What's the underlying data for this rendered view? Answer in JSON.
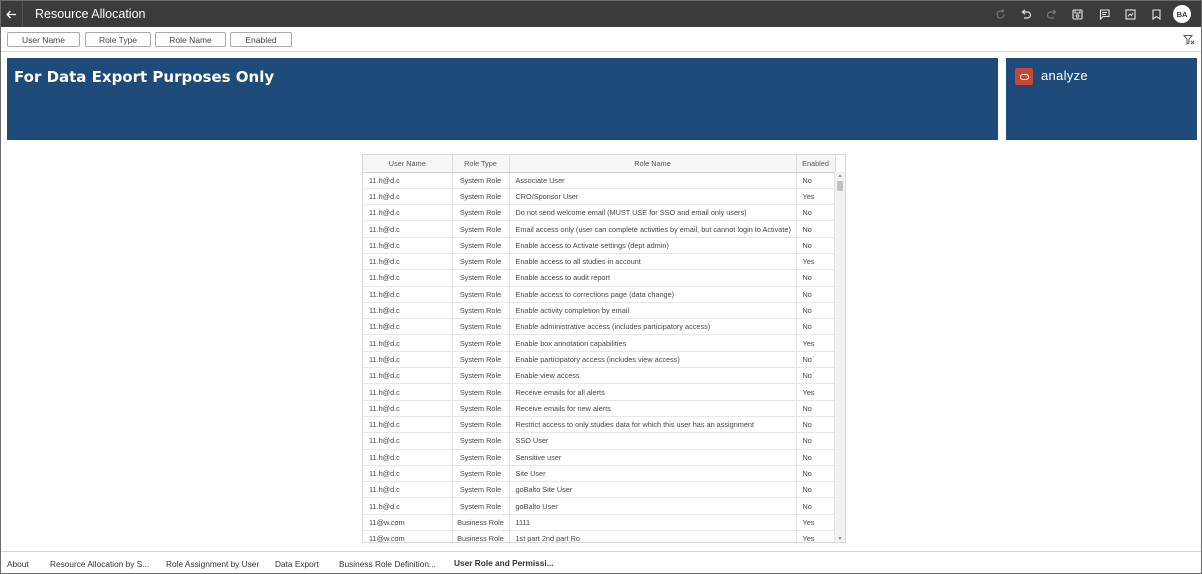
{
  "app": {
    "title": "Resource Allocation",
    "user_initials": "BA"
  },
  "toolbar": {
    "back_icon": "arrow-left-icon",
    "icons": [
      "refresh-icon",
      "undo-icon",
      "redo-icon",
      "save-icon",
      "comment-icon",
      "present-icon",
      "bookmark-icon"
    ]
  },
  "filters": [
    "User Name",
    "Role Type",
    "Role Name",
    "Enabled"
  ],
  "banner": {
    "title": "For Data Export Purposes Only"
  },
  "brand": {
    "text": "analyze",
    "logo_color": "#c74634"
  },
  "colors": {
    "banner": "#1f4b7a",
    "topbar": "#3b3b3b",
    "active_tab": "#2e7d32"
  },
  "table": {
    "headers": [
      "User Name",
      "Role Type",
      "Role Name",
      "Enabled"
    ],
    "rows": [
      [
        "11.h@d.c",
        "System Role",
        "Associate User",
        "No"
      ],
      [
        "11.h@d.c",
        "System Role",
        "CRO/Sponsor User",
        "Yes"
      ],
      [
        "11.h@d.c",
        "System Role",
        "Do not send welcome email (MUST USE for SSO and email only users)",
        "No"
      ],
      [
        "11.h@d.c",
        "System Role",
        "Email access only (user can complete activities by email, but cannot login to Activate)",
        "No"
      ],
      [
        "11.h@d.c",
        "System Role",
        "Enable access to Activate settings (dept admin)",
        "No"
      ],
      [
        "11.h@d.c",
        "System Role",
        "Enable access to all studies in account",
        "Yes"
      ],
      [
        "11.h@d.c",
        "System Role",
        "Enable access to audit report",
        "No"
      ],
      [
        "11.h@d.c",
        "System Role",
        "Enable access to corrections page (data change)",
        "No"
      ],
      [
        "11.h@d.c",
        "System Role",
        "Enable activity completion by email",
        "No"
      ],
      [
        "11.h@d.c",
        "System Role",
        "Enable administrative access (includes participatory access)",
        "No"
      ],
      [
        "11.h@d.c",
        "System Role",
        "Enable box annotation capabilities",
        "Yes"
      ],
      [
        "11.h@d.c",
        "System Role",
        "Enable participatory access (includes view access)",
        "No"
      ],
      [
        "11.h@d.c",
        "System Role",
        "Enable view access",
        "No"
      ],
      [
        "11.h@d.c",
        "System Role",
        "Receive emails for all alerts",
        "Yes"
      ],
      [
        "11.h@d.c",
        "System Role",
        "Receive emails for new alerts",
        "No"
      ],
      [
        "11.h@d.c",
        "System Role",
        "Restrict access to only studies data for which this user has an assignment",
        "No"
      ],
      [
        "11.h@d.c",
        "System Role",
        "SSO User",
        "No"
      ],
      [
        "11.h@d.c",
        "System Role",
        "Sensitive user",
        "No"
      ],
      [
        "11.h@d.c",
        "System Role",
        "Site User",
        "No"
      ],
      [
        "11.h@d.c",
        "System Role",
        "goBalto Site User",
        "No"
      ],
      [
        "11.h@d.c",
        "System Role",
        "goBalto User",
        "No"
      ],
      [
        "11@w.com",
        "Business Role",
        "1111",
        "Yes"
      ],
      [
        "11@w.com",
        "Business Role",
        "1st part 2nd part Ro",
        "Yes"
      ]
    ]
  },
  "tabs": [
    {
      "label": "About",
      "active": false
    },
    {
      "label": "Resource Allocation by S...",
      "active": false
    },
    {
      "label": "Role Assignment by User",
      "active": false
    },
    {
      "label": "Data Export",
      "active": false
    },
    {
      "label": "Business Role Definition...",
      "active": false
    },
    {
      "label": "User Role and Permissi...",
      "active": true
    }
  ]
}
